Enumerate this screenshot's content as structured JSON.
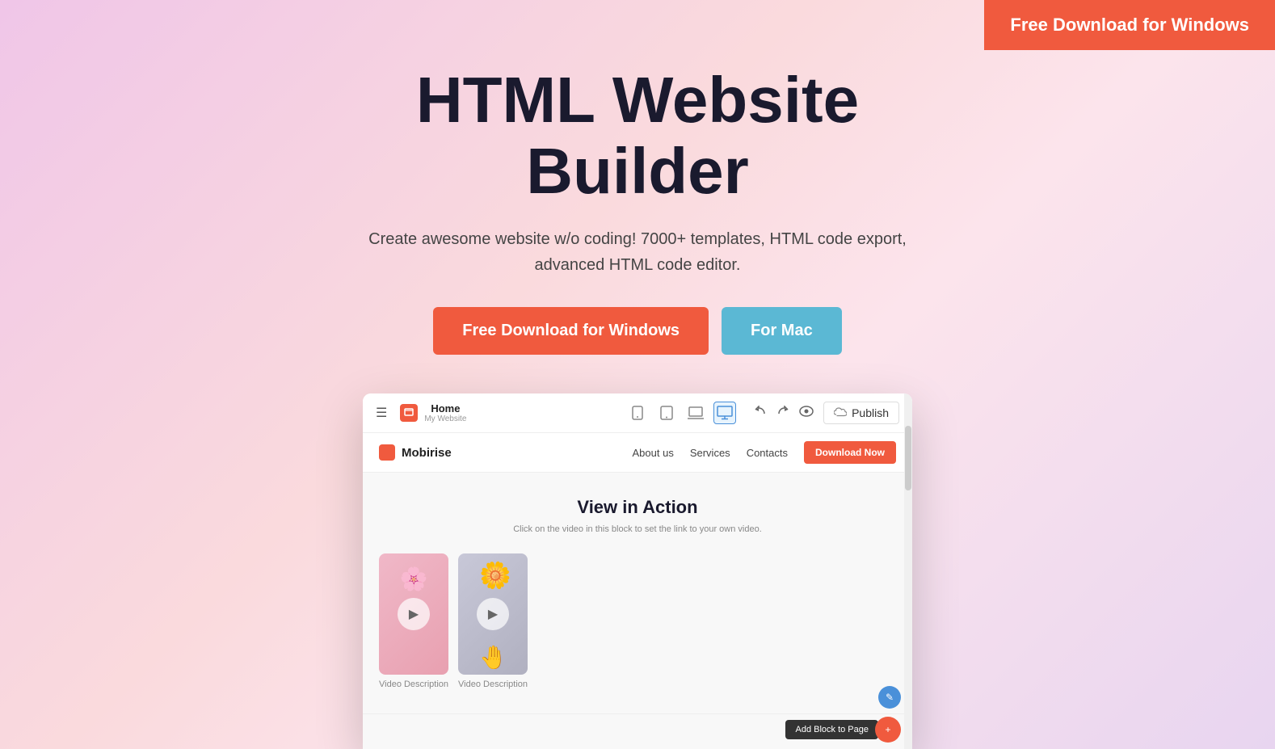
{
  "topCta": {
    "label": "Free Download for Windows"
  },
  "hero": {
    "title": "HTML Website Builder",
    "subtitle": "Create awesome website w/o coding! 7000+ templates, HTML code export, advanced HTML code editor.",
    "buttons": {
      "windows": "Free Download for Windows",
      "mac": "For Mac"
    }
  },
  "mockup": {
    "toolbar": {
      "menuIcon": "☰",
      "homeLabel": "Home",
      "homeSub": "My Website",
      "deviceIcons": [
        "phone",
        "tablet",
        "laptop",
        "desktop"
      ],
      "undoIcon": "←",
      "redoIcon": "→",
      "previewIcon": "👁",
      "publishIcon": "☁",
      "publishLabel": "Publish"
    },
    "navbar": {
      "logoText": "Mobirise",
      "links": [
        "About us",
        "Services",
        "Contacts"
      ],
      "ctaButton": "Download Now"
    },
    "content": {
      "title": "View in Action",
      "subtitle": "Click on the video in this block to set the link to your own video.",
      "videos": [
        {
          "desc": "Video Description"
        },
        {
          "desc": "Video Description"
        }
      ]
    },
    "addBlockLabel": "Add Block to Page",
    "orangeButtonIcon": "+",
    "blueButtonIcon": "✎"
  }
}
